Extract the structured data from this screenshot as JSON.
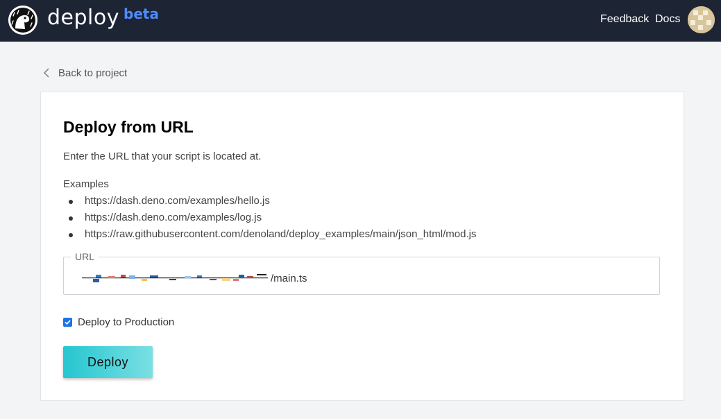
{
  "header": {
    "logo_text": "deploy",
    "logo_badge": "beta",
    "nav": [
      {
        "label": "Feedback"
      },
      {
        "label": "Docs"
      }
    ]
  },
  "back": {
    "label": "Back to project"
  },
  "card": {
    "title": "Deploy from URL",
    "intro": "Enter the URL that your script is located at.",
    "examples_label": "Examples",
    "examples": [
      "https://dash.deno.com/examples/hello.js",
      "https://dash.deno.com/examples/log.js",
      "https://raw.githubusercontent.com/denoland/deploy_examples/main/json_html/mod.js"
    ],
    "url_field": {
      "label": "URL",
      "value_suffix": "/main.ts"
    },
    "production": {
      "label": "Deploy to Production",
      "checked": true
    },
    "deploy_button": "Deploy"
  },
  "colors": {
    "header_bg": "#1d2433",
    "beta": "#4f8cff",
    "button_gradient_start": "#25c6d0",
    "button_gradient_end": "#7adfe3",
    "checkbox": "#1a73e8"
  }
}
